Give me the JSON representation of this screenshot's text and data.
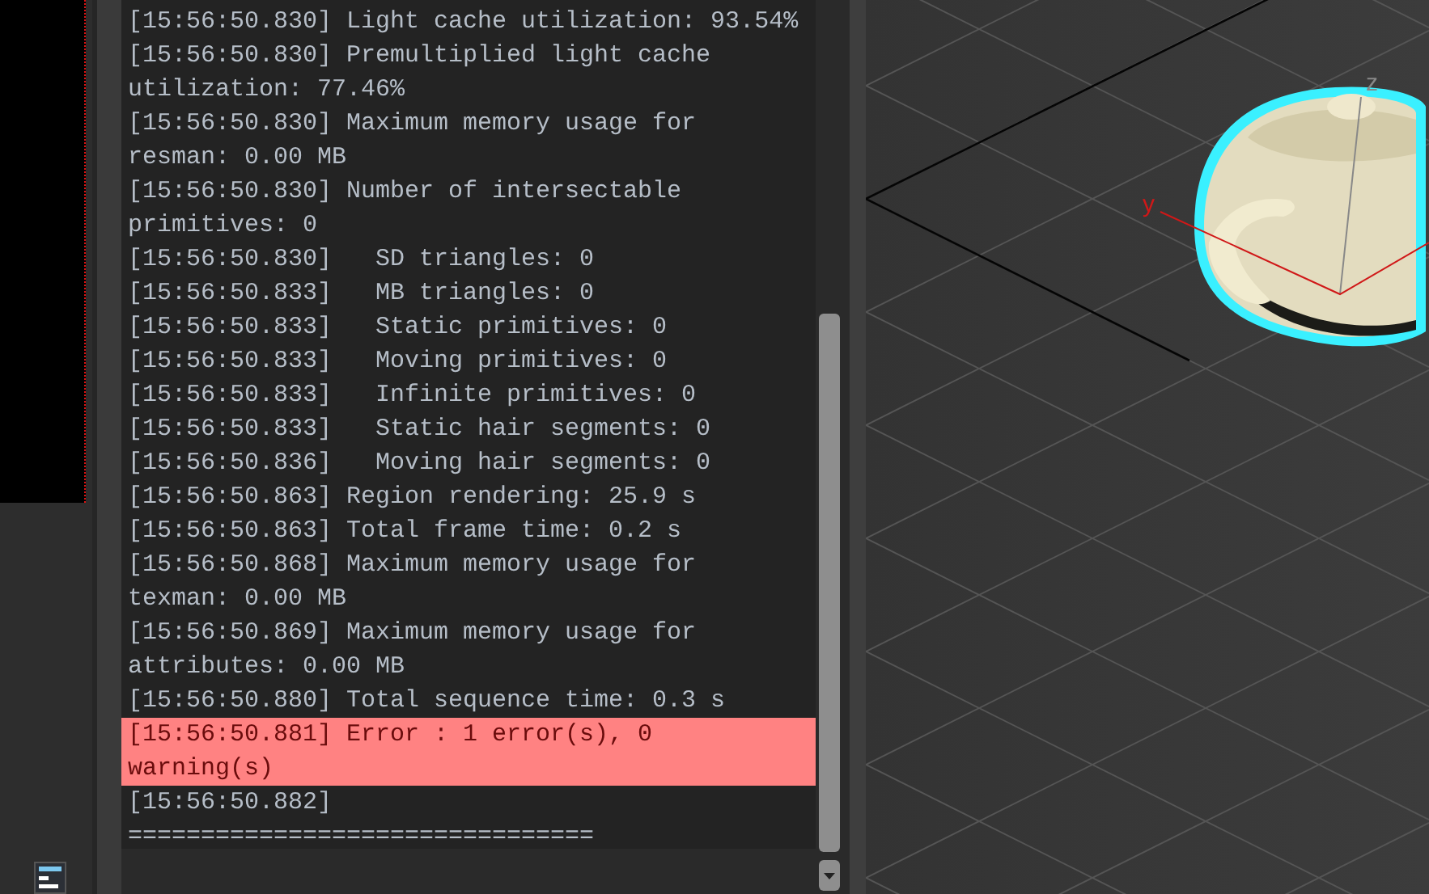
{
  "log": {
    "entries": [
      {
        "kind": "normal",
        "text": "[15:56:50.830] Light cache utilization: 93.54%"
      },
      {
        "kind": "normal",
        "text": "[15:56:50.830] Premultiplied light cache utilization: 77.46%"
      },
      {
        "kind": "normal",
        "text": "[15:56:50.830] Maximum memory usage for resman: 0.00 MB"
      },
      {
        "kind": "normal",
        "text": "[15:56:50.830] Number of intersectable primitives: 0"
      },
      {
        "kind": "normal",
        "text": "[15:56:50.830]   SD triangles: 0"
      },
      {
        "kind": "normal",
        "text": "[15:56:50.833]   MB triangles: 0"
      },
      {
        "kind": "normal",
        "text": "[15:56:50.833]   Static primitives: 0"
      },
      {
        "kind": "normal",
        "text": "[15:56:50.833]   Moving primitives: 0"
      },
      {
        "kind": "normal",
        "text": "[15:56:50.833]   Infinite primitives: 0"
      },
      {
        "kind": "normal",
        "text": "[15:56:50.833]   Static hair segments: 0"
      },
      {
        "kind": "normal",
        "text": "[15:56:50.836]   Moving hair segments: 0"
      },
      {
        "kind": "normal",
        "text": "[15:56:50.863] Region rendering: 25.9 s"
      },
      {
        "kind": "normal",
        "text": "[15:56:50.863] Total frame time: 0.2 s"
      },
      {
        "kind": "normal",
        "text": "[15:56:50.868] Maximum memory usage for texman: 0.00 MB"
      },
      {
        "kind": "normal",
        "text": "[15:56:50.869] Maximum memory usage for attributes: 0.00 MB"
      },
      {
        "kind": "normal",
        "text": "[15:56:50.880] Total sequence time: 0.3 s"
      },
      {
        "kind": "error",
        "text": "[15:56:50.881] Error : 1 error(s), 0 warning(s)"
      },
      {
        "kind": "normal",
        "text": "[15:56:50.882]"
      },
      {
        "kind": "normal",
        "text": "================================"
      }
    ]
  },
  "viewport": {
    "y_axis_label": "y",
    "z_axis_label": "z"
  }
}
